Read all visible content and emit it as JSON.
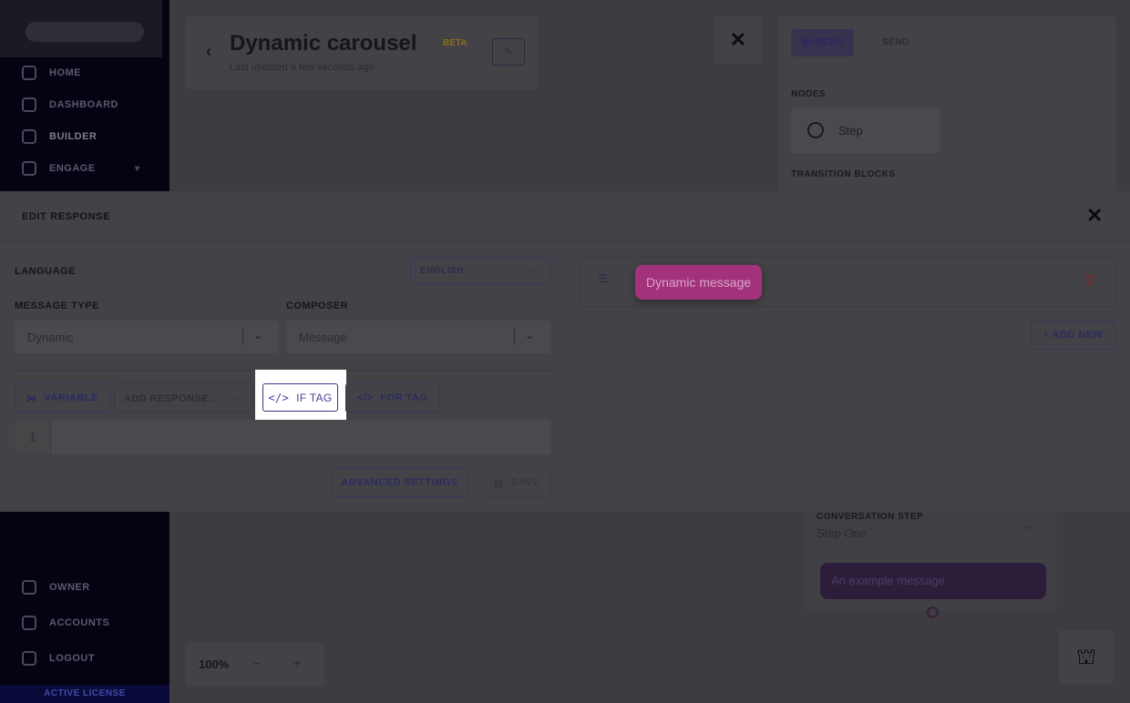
{
  "sidebar": {
    "items": [
      {
        "label": "HOME",
        "icon": "home-icon"
      },
      {
        "label": "DASHBOARD",
        "icon": "chart-icon"
      },
      {
        "label": "BUILDER",
        "icon": "builder-icon"
      },
      {
        "label": "ENGAGE",
        "icon": "engage-icon"
      }
    ],
    "bottom_items": [
      {
        "label": "OWNER",
        "icon": "wrench-icon"
      },
      {
        "label": "ACCOUNTS",
        "icon": "user-icon"
      },
      {
        "label": "LOGOUT",
        "icon": "logout-icon"
      }
    ],
    "license": "ACTIVE LICENSE"
  },
  "header": {
    "title": "Dynamic carousel",
    "badge": "BETA",
    "subtitle": "Last updated a few seconds ago"
  },
  "right_panel": {
    "tabs": [
      "BLOCKS",
      "SEND"
    ],
    "nodes_label": "NODES",
    "node_name": "Step",
    "transition_label": "TRANSITION BLOCKS"
  },
  "canvas": {
    "step_label": "CONVERSATION STEP",
    "step_value": "Step One",
    "step_message": "An example message",
    "zoom": "100%"
  },
  "modal": {
    "title": "EDIT RESPONSE",
    "language_label": "LANGUAGE",
    "language_value": "ENGLISH",
    "message_type_label": "MESSAGE TYPE",
    "message_type_value": "Dynamic",
    "composer_label": "COMPOSER",
    "composer_value": "Message",
    "toolbar": {
      "variable": "VARIABLE",
      "add_response_placeholder": "ADD RESPONSE...",
      "if_tag": "IF TAG",
      "for_tag": "FOR TAG"
    },
    "editor_line": "1",
    "advanced_settings": "ADVANCED SETTINGS",
    "save": "SAVE",
    "response_pill": "Dynamic message",
    "add_new": "+ ADD NEW"
  }
}
